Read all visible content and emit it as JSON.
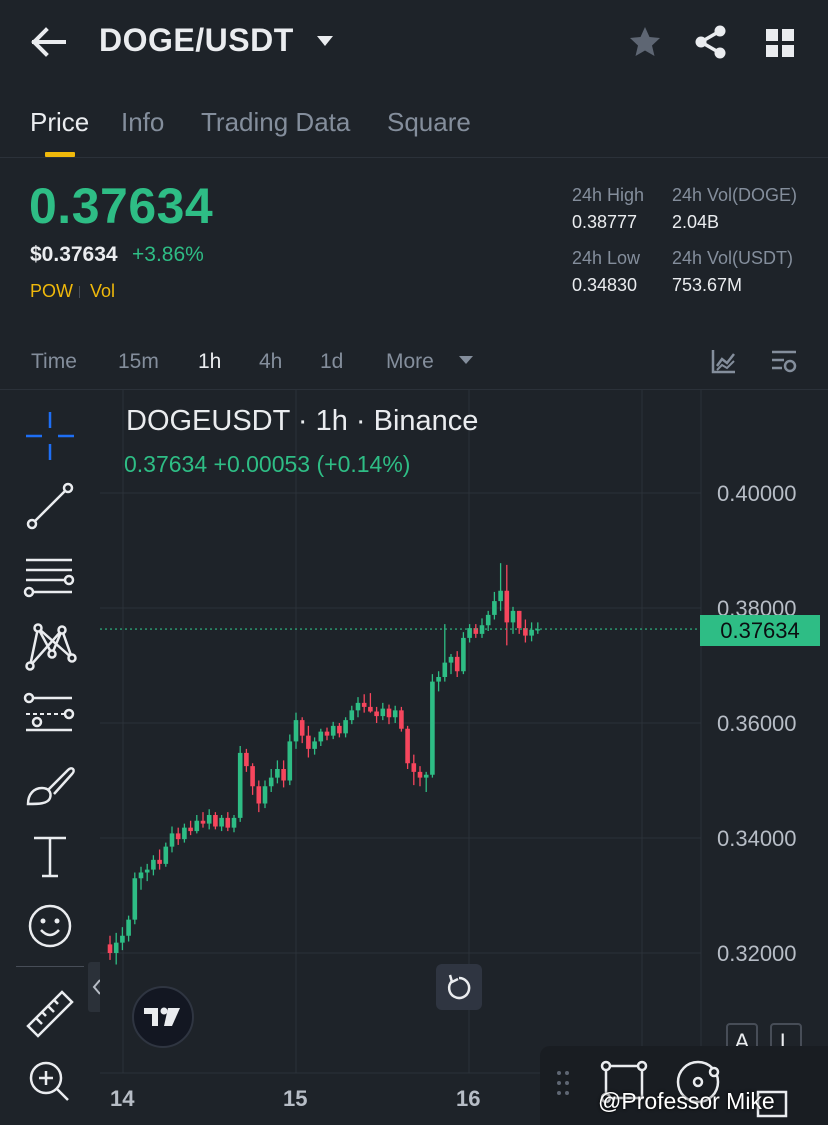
{
  "header": {
    "pair": "DOGE/USDT",
    "icons": [
      "back-arrow-icon",
      "caret-down-icon",
      "star-icon",
      "share-icon",
      "grid-icon"
    ]
  },
  "tabs": [
    {
      "label": "Price",
      "active": true
    },
    {
      "label": "Info",
      "active": false
    },
    {
      "label": "Trading Data",
      "active": false
    },
    {
      "label": "Square",
      "active": false
    }
  ],
  "ticker": {
    "last_price": "0.37634",
    "usd_price": "$0.37634",
    "change_pct": "+3.86%",
    "indicator_1": "POW",
    "indicator_2": "Vol"
  },
  "stats": {
    "high_label": "24h High",
    "high_value": "0.38777",
    "low_label": "24h Low",
    "low_value": "0.34830",
    "vol_base_label": "24h Vol(DOGE)",
    "vol_base_value": "2.04B",
    "vol_quote_label": "24h Vol(USDT)",
    "vol_quote_value": "753.67M"
  },
  "intervals": {
    "items": [
      "Time",
      "15m",
      "1h",
      "4h",
      "1d"
    ],
    "active": "1h",
    "more_label": "More"
  },
  "chart": {
    "title": "DOGEUSDT · 1h · Binance",
    "subtitle": "0.37634  +0.00053 (+0.14%)",
    "y_ticks": [
      "0.40000",
      "0.38000",
      "0.36000",
      "0.34000",
      "0.32000"
    ],
    "x_ticks": [
      "14",
      "15",
      "16"
    ],
    "last_price_badge": "0.37634",
    "up_color": "#2ebd85",
    "down_color": "#f6465d"
  },
  "chart_data": {
    "type": "candlestick",
    "title": "DOGEUSDT · 1h · Binance",
    "x_ticks": [
      "14",
      "15",
      "16"
    ],
    "y_ticks": [
      0.4,
      0.38,
      0.36,
      0.34,
      0.32
    ],
    "last_price": 0.37634,
    "ohlc": [
      [
        0.3215,
        0.323,
        0.3188,
        0.32
      ],
      [
        0.32,
        0.3235,
        0.318,
        0.3218
      ],
      [
        0.3218,
        0.3245,
        0.3205,
        0.323
      ],
      [
        0.323,
        0.3265,
        0.322,
        0.3258
      ],
      [
        0.3258,
        0.334,
        0.325,
        0.333
      ],
      [
        0.333,
        0.335,
        0.331,
        0.334
      ],
      [
        0.334,
        0.3355,
        0.3325,
        0.3345
      ],
      [
        0.3345,
        0.337,
        0.3335,
        0.3362
      ],
      [
        0.3362,
        0.338,
        0.3345,
        0.3355
      ],
      [
        0.3355,
        0.3392,
        0.335,
        0.3385
      ],
      [
        0.3385,
        0.342,
        0.3375,
        0.3408
      ],
      [
        0.3408,
        0.3418,
        0.3388,
        0.3398
      ],
      [
        0.3398,
        0.3425,
        0.3392,
        0.3418
      ],
      [
        0.3418,
        0.343,
        0.3405,
        0.3412
      ],
      [
        0.3412,
        0.344,
        0.3408,
        0.343
      ],
      [
        0.343,
        0.3445,
        0.3418,
        0.3425
      ],
      [
        0.3425,
        0.345,
        0.3415,
        0.344
      ],
      [
        0.344,
        0.3445,
        0.3415,
        0.342
      ],
      [
        0.342,
        0.344,
        0.3412,
        0.3435
      ],
      [
        0.3435,
        0.3445,
        0.3412,
        0.3418
      ],
      [
        0.3418,
        0.344,
        0.341,
        0.3435
      ],
      [
        0.3435,
        0.356,
        0.3428,
        0.3548
      ],
      [
        0.3548,
        0.3555,
        0.3515,
        0.3525
      ],
      [
        0.3525,
        0.353,
        0.3475,
        0.349
      ],
      [
        0.349,
        0.35,
        0.3445,
        0.346
      ],
      [
        0.346,
        0.35,
        0.3452,
        0.349
      ],
      [
        0.349,
        0.352,
        0.348,
        0.3505
      ],
      [
        0.3505,
        0.3535,
        0.3495,
        0.352
      ],
      [
        0.352,
        0.3535,
        0.3488,
        0.35
      ],
      [
        0.35,
        0.358,
        0.3492,
        0.3568
      ],
      [
        0.3568,
        0.3618,
        0.3555,
        0.3605
      ],
      [
        0.3605,
        0.361,
        0.3565,
        0.3578
      ],
      [
        0.3578,
        0.3595,
        0.354,
        0.3555
      ],
      [
        0.3555,
        0.3575,
        0.3545,
        0.3568
      ],
      [
        0.3568,
        0.359,
        0.356,
        0.3585
      ],
      [
        0.3585,
        0.3592,
        0.357,
        0.3578
      ],
      [
        0.3578,
        0.3602,
        0.3572,
        0.3595
      ],
      [
        0.3595,
        0.36,
        0.3575,
        0.3582
      ],
      [
        0.3582,
        0.361,
        0.3575,
        0.3605
      ],
      [
        0.3605,
        0.363,
        0.3598,
        0.3622
      ],
      [
        0.3622,
        0.3645,
        0.361,
        0.3635
      ],
      [
        0.3635,
        0.365,
        0.3618,
        0.3628
      ],
      [
        0.3628,
        0.3652,
        0.3618,
        0.362
      ],
      [
        0.362,
        0.3628,
        0.36,
        0.3612
      ],
      [
        0.3612,
        0.3635,
        0.3605,
        0.3625
      ],
      [
        0.3625,
        0.3632,
        0.3598,
        0.361
      ],
      [
        0.361,
        0.363,
        0.36,
        0.3622
      ],
      [
        0.3622,
        0.3628,
        0.3585,
        0.359
      ],
      [
        0.359,
        0.3595,
        0.352,
        0.353
      ],
      [
        0.353,
        0.3545,
        0.3492,
        0.3515
      ],
      [
        0.3515,
        0.3525,
        0.349,
        0.3505
      ],
      [
        0.3505,
        0.3515,
        0.348,
        0.351
      ],
      [
        0.351,
        0.3685,
        0.3505,
        0.3672
      ],
      [
        0.3672,
        0.369,
        0.3655,
        0.368
      ],
      [
        0.368,
        0.3772,
        0.3672,
        0.3705
      ],
      [
        0.3705,
        0.372,
        0.3685,
        0.3715
      ],
      [
        0.3715,
        0.3725,
        0.368,
        0.369
      ],
      [
        0.369,
        0.3758,
        0.3685,
        0.3748
      ],
      [
        0.3748,
        0.3772,
        0.374,
        0.3765
      ],
      [
        0.3765,
        0.3772,
        0.3748,
        0.3755
      ],
      [
        0.3755,
        0.3782,
        0.3748,
        0.377
      ],
      [
        0.377,
        0.3795,
        0.376,
        0.3788
      ],
      [
        0.3788,
        0.3828,
        0.378,
        0.3812
      ],
      [
        0.3812,
        0.3878,
        0.3795,
        0.383
      ],
      [
        0.383,
        0.3875,
        0.3735,
        0.3775
      ],
      [
        0.3775,
        0.3802,
        0.3755,
        0.3795
      ],
      [
        0.3795,
        0.3795,
        0.3755,
        0.3765
      ],
      [
        0.3765,
        0.378,
        0.374,
        0.3752
      ],
      [
        0.3752,
        0.3775,
        0.3742,
        0.3762
      ],
      [
        0.3762,
        0.3775,
        0.3755,
        0.3763
      ]
    ]
  },
  "overlay": {
    "key_a": "A",
    "key_l": "L",
    "watermark": "@Professor Mike"
  }
}
